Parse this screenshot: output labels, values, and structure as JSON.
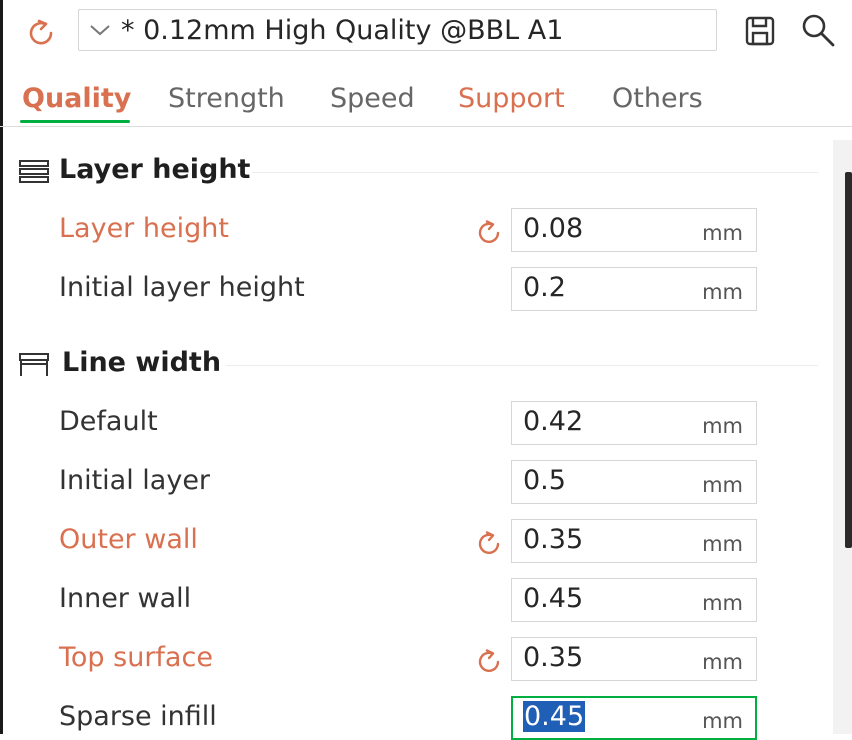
{
  "header": {
    "preset_name": "* 0.12mm High Quality @BBL A1",
    "icons": [
      "reset-icon",
      "chevron-down-icon",
      "save-icon",
      "search-icon"
    ]
  },
  "tabs": [
    {
      "label": "Quality",
      "active": true
    },
    {
      "label": "Strength"
    },
    {
      "label": "Speed"
    },
    {
      "label": "Support",
      "modified": true
    },
    {
      "label": "Others"
    }
  ],
  "sections": {
    "layer_height": {
      "title": "Layer height",
      "rows": [
        {
          "label": "Layer height",
          "value": "0.08",
          "unit": "mm",
          "modified": true
        },
        {
          "label": "Initial layer height",
          "value": "0.2",
          "unit": "mm"
        }
      ]
    },
    "line_width": {
      "title": "Line width",
      "rows": [
        {
          "label": "Default",
          "value": "0.42",
          "unit": "mm"
        },
        {
          "label": "Initial layer",
          "value": "0.5",
          "unit": "mm"
        },
        {
          "label": "Outer wall",
          "value": "0.35",
          "unit": "mm",
          "modified": true
        },
        {
          "label": "Inner wall",
          "value": "0.45",
          "unit": "mm"
        },
        {
          "label": "Top surface",
          "value": "0.35",
          "unit": "mm",
          "modified": true
        },
        {
          "label": "Sparse infill",
          "value": "0.45",
          "unit": "mm",
          "focused": true
        }
      ]
    }
  },
  "colors": {
    "modified": "#d9704f",
    "accent": "#00ae42",
    "selection": "#1f5fb5"
  }
}
